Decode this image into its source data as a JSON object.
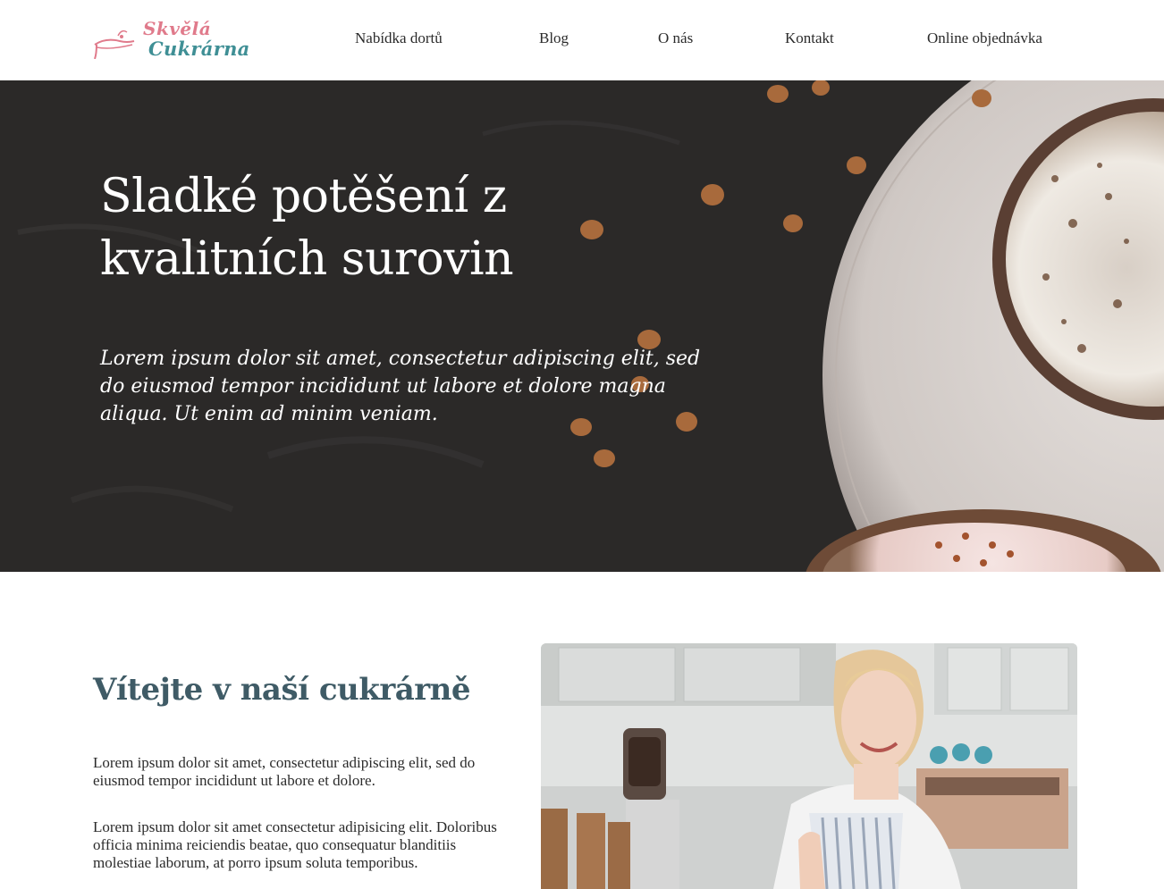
{
  "header": {
    "logo": {
      "line1": "Skvělá",
      "line2": "Cukrárna"
    },
    "nav": [
      {
        "label": "Nabídka dortů"
      },
      {
        "label": "Blog"
      },
      {
        "label": "O nás"
      },
      {
        "label": "Kontakt"
      },
      {
        "label": "Online objednávka"
      }
    ]
  },
  "hero": {
    "title": "Sladké potěšení z kvalitních surovin",
    "text": "Lorem ipsum dolor sit amet, consectetur adipiscing elit, sed do eiusmod tempor incididunt ut labore et dolore magna aliqua. Ut enim ad minim veniam."
  },
  "welcome": {
    "title": "Vítejte v naší cukrárně",
    "paragraph1": "Lorem ipsum dolor sit amet, consectetur adipiscing elit, sed do eiusmod tempor incididunt ut labore et dolore.",
    "paragraph2": "Lorem ipsum dolor sit amet consectetur adipisicing elit. Doloribus officia minima reiciendis beatae, quo consequatur blanditiis molestiae laborum, at porro ipsum soluta temporibus."
  },
  "colors": {
    "logo_pink": "#e07a8b",
    "logo_teal": "#3f8f95",
    "heading_teal": "#3f5b66",
    "hero_bg": "#2c2a29"
  }
}
